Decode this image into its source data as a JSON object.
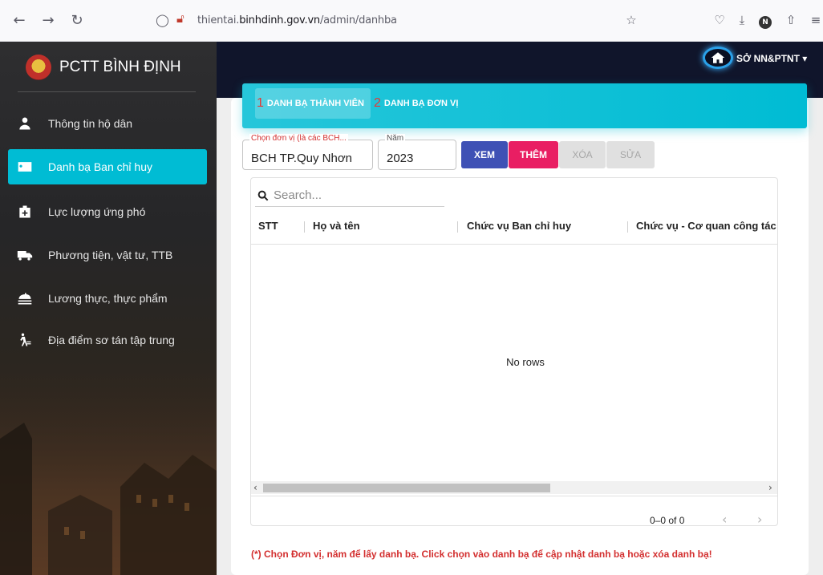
{
  "browser": {
    "url_prefix": "thientai.",
    "url_domain": "binhdinh.gov.vn",
    "url_path": "/admin/danhba",
    "back_icon": "back-arrow-icon",
    "forward_icon": "forward-arrow-icon",
    "reload_icon": "reload-icon"
  },
  "sidebar": {
    "brand": "PCTT BÌNH ĐỊNH",
    "items": [
      {
        "label": "Thông tin hộ dân",
        "icon": "person-icon"
      },
      {
        "label": "Danh bạ Ban chỉ huy",
        "icon": "contact-card-icon",
        "active": true
      },
      {
        "label": "Lực lượng ứng phó",
        "icon": "medkit-icon"
      },
      {
        "label": "Phương tiện, vật tư, TTB",
        "icon": "truck-icon"
      },
      {
        "label": "Lương thực, thực phẩm",
        "icon": "food-icon"
      },
      {
        "label": "Địa điểm sơ tán tập trung",
        "icon": "evacuation-icon"
      }
    ]
  },
  "header": {
    "user": "SỞ NN&PTNT ▾"
  },
  "tabs": [
    {
      "num": "1",
      "label": "DANH BẠ THÀNH VIÊN",
      "active": true
    },
    {
      "num": "2",
      "label": "DANH BẠ ĐƠN VỊ",
      "active": false
    }
  ],
  "filters": {
    "unit_label": "Chọn đơn vị (là các BCH...",
    "unit_value": "BCH TP.Quy Nhơn",
    "year_label": "Năm",
    "year_value": "2023"
  },
  "actions": {
    "view": "XEM",
    "add": "THÊM",
    "delete": "XÓA",
    "edit": "SỬA"
  },
  "grid": {
    "search_placeholder": "Search...",
    "columns": [
      "STT",
      "Họ và tên",
      "Chức vụ Ban chỉ huy",
      "Chức vụ - Cơ quan công tác"
    ],
    "empty": "No rows",
    "pagination": "0–0 of 0"
  },
  "note": "(*) Chọn Đơn vị, năm để lấy danh bạ. Click chọn vào danh bạ để cập nhật danh bạ hoặc xóa danh bạ!",
  "colors": {
    "accent": "#00bcd4",
    "primary": "#3f51b5",
    "danger": "#e91e63",
    "warning_text": "#d32f2f"
  }
}
